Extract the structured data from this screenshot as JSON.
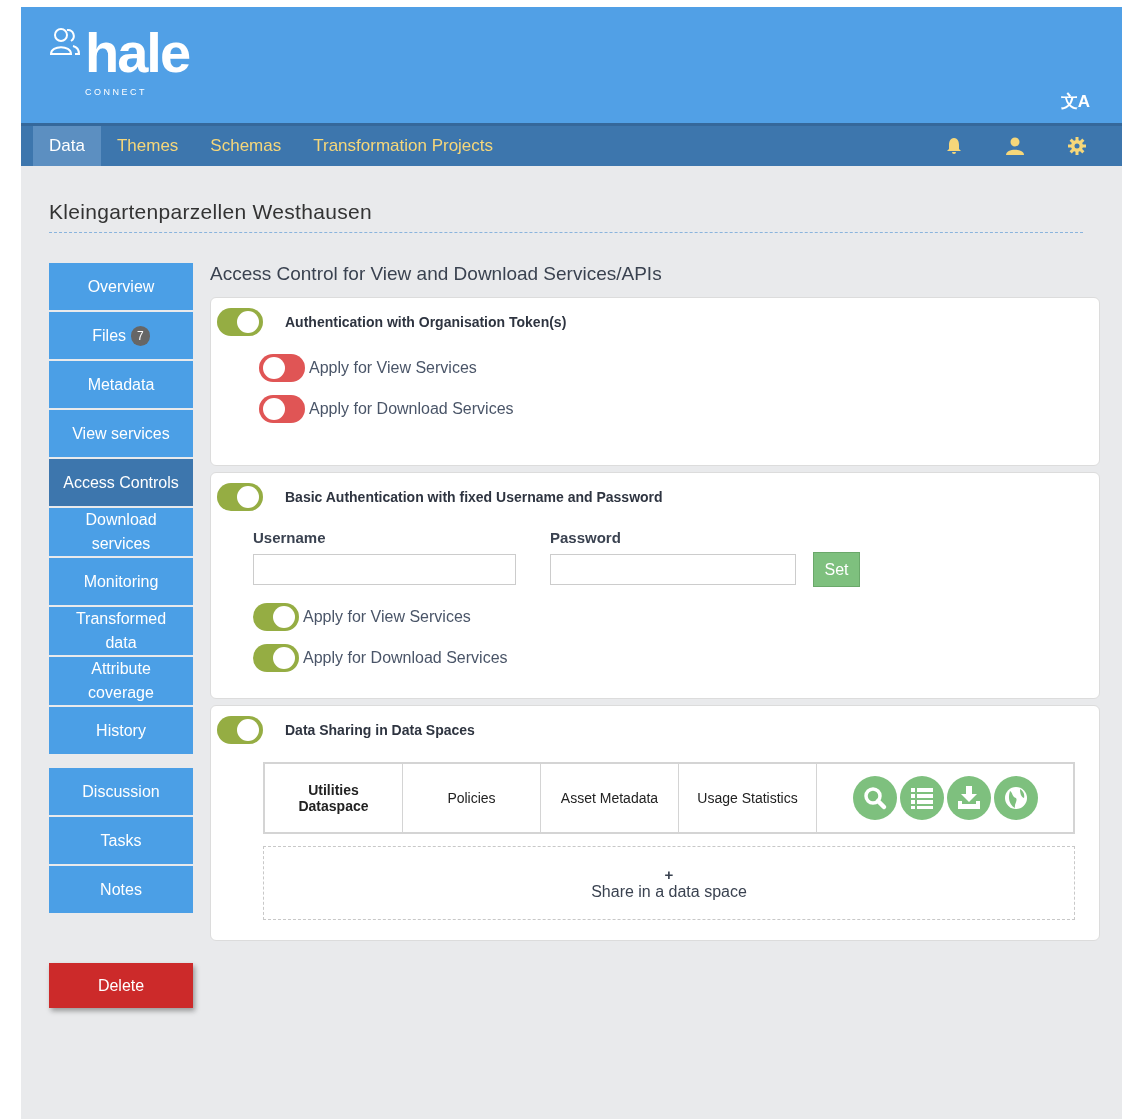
{
  "header": {
    "logo": "hale",
    "logo_subtitle": "CONNECT",
    "language": "文A"
  },
  "nav": {
    "tabs": [
      {
        "label": "Data",
        "selected": true
      },
      {
        "label": "Themes",
        "selected": false
      },
      {
        "label": "Schemas",
        "selected": false
      },
      {
        "label": "Transformation Projects",
        "selected": false
      }
    ]
  },
  "page_title": "Kleingartenparzellen Westhausen",
  "sidebar": {
    "groups": [
      {
        "items": [
          {
            "label": "Overview",
            "selected": false
          },
          {
            "label": "Files",
            "badge": "7",
            "selected": false
          },
          {
            "label": "Metadata",
            "selected": false
          },
          {
            "label": "View services",
            "selected": false
          },
          {
            "label": "Access Controls",
            "selected": true
          },
          {
            "label": "Download services",
            "selected": false
          },
          {
            "label": "Monitoring",
            "selected": false
          },
          {
            "label": "Transformed data",
            "selected": false
          },
          {
            "label": "Attribute coverage",
            "selected": false
          },
          {
            "label": "History",
            "selected": false
          }
        ]
      },
      {
        "items": [
          {
            "label": "Discussion",
            "selected": false
          },
          {
            "label": "Tasks",
            "selected": false
          },
          {
            "label": "Notes",
            "selected": false
          }
        ]
      }
    ],
    "delete": "Delete"
  },
  "section_title": "Access Control for View and Download Services/APIs",
  "panels": [
    {
      "kind": "token",
      "title": "Authentication with Organisation Token(s)",
      "on": true,
      "options": [
        {
          "label": "Apply for View Services",
          "on": false
        },
        {
          "label": "Apply for Download Services",
          "on": false
        }
      ]
    },
    {
      "kind": "basic",
      "title": "Basic Authentication with fixed Username and Password",
      "on": true,
      "fields": [
        {
          "label": "Username"
        },
        {
          "label": "Password"
        }
      ],
      "set_button": "Set",
      "options": [
        {
          "label": "Apply for View Services",
          "on": true
        },
        {
          "label": "Apply for Download Services",
          "on": true
        }
      ]
    },
    {
      "kind": "sharing",
      "title": "Data Sharing in Data Spaces",
      "on": true,
      "dataspaces": [
        {
          "cells": [
            "Utilities Dataspace",
            "Policies",
            "Asset Metadata",
            "Usage Statistics"
          ]
        }
      ],
      "add": {
        "icon": "+",
        "label": "Share in a data space"
      }
    }
  ]
}
